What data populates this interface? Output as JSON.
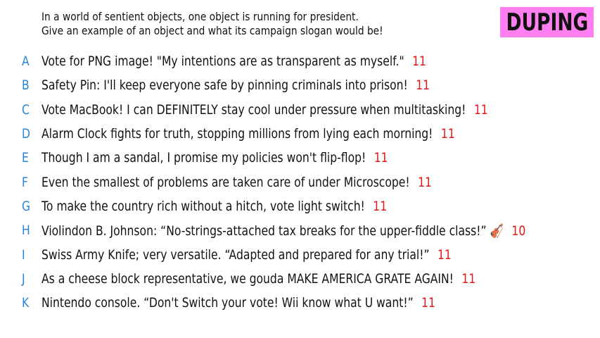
{
  "prompt": {
    "line1": "In a world of sentient objects, one object is running for president.",
    "line2": "Give an example of an object and what its campaign slogan would be!"
  },
  "phase_label": "DUPING",
  "colors": {
    "badge_bg": "#ff7ef0",
    "letter": "#2a84d6",
    "score": "#e01818",
    "text": "#111111"
  },
  "answers": [
    {
      "letter": "A",
      "text": "Vote for PNG image! \"My intentions are as transparent as myself.\"",
      "emoji": "",
      "score": "11"
    },
    {
      "letter": "B",
      "text": "Safety Pin: I'll keep everyone safe by pinning criminals into prison!",
      "emoji": "",
      "score": "11"
    },
    {
      "letter": "C",
      "text": "Vote MacBook! I can DEFINITELY stay cool under pressure when multitasking!",
      "emoji": "",
      "score": "11"
    },
    {
      "letter": "D",
      "text": "Alarm Clock fights for truth, stopping millions from lying each morning!",
      "emoji": "",
      "score": "11"
    },
    {
      "letter": "E",
      "text": "Though I am a sandal, I promise my policies won't flip-flop!",
      "emoji": "",
      "score": "11"
    },
    {
      "letter": "F",
      "text": "Even the smallest of problems are taken care of under Microscope!",
      "emoji": "",
      "score": "11"
    },
    {
      "letter": "G",
      "text": "To make the country rich without a hitch, vote light switch!",
      "emoji": "",
      "score": "11"
    },
    {
      "letter": "H",
      "text": "Violindon B. Johnson: “No-strings-attached tax breaks for the upper-fiddle class!”",
      "emoji": "🎻",
      "score": "10"
    },
    {
      "letter": "I",
      "text": "Swiss Army Knife; very versatile. “Adapted and prepared for any trial!”",
      "emoji": "",
      "score": "11"
    },
    {
      "letter": "J",
      "text": "As a cheese block representative, we gouda MAKE AMERICA GRATE AGAIN!",
      "emoji": "",
      "score": "11"
    },
    {
      "letter": "K",
      "text": "Nintendo console. “Don't Switch your vote! Wii know what U want!”",
      "emoji": "",
      "score": "11"
    }
  ]
}
